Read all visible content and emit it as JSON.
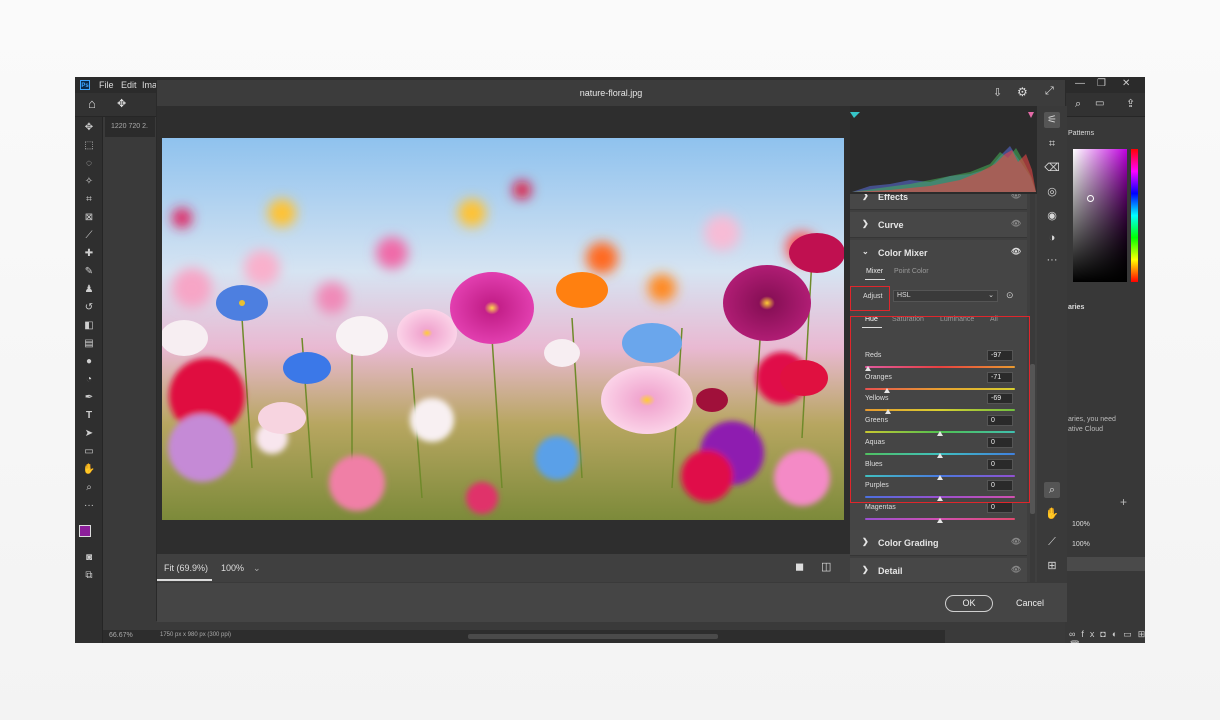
{
  "app": {
    "logo": "Ps",
    "menu": [
      "File",
      "Edit",
      "Ima"
    ],
    "doc_size_label": "1220 720 2.",
    "zoom_status": "66.67%",
    "doc_info": "1750 px x 980 px (300 ppi)"
  },
  "right_panel": {
    "patterns_label": "Patterns",
    "libraries_label": "aries",
    "libraries_msg_1": "aries, you need",
    "libraries_msg_2": "ative Cloud",
    "pct_1": "100%",
    "pct_2": "100%"
  },
  "dialog": {
    "title": "nature-floral.jpg",
    "zoom_fit": "Fit (69.9%)",
    "zoom_100": "100%",
    "ok_label": "OK",
    "cancel_label": "Cancel"
  },
  "sections": {
    "effects": "Effects",
    "curve": "Curve",
    "color_mixer": "Color Mixer",
    "color_grading": "Color Grading",
    "detail": "Detail"
  },
  "mixer": {
    "tabs": [
      "Mixer",
      "Point Color"
    ],
    "adjust_label": "Adjust",
    "adjust_value": "HSL",
    "subtabs": [
      "Hue",
      "Saturation",
      "Luminance",
      "All"
    ],
    "sliders": [
      {
        "name": "Reds",
        "value": "-97",
        "pos": 0.02
      },
      {
        "name": "Oranges",
        "value": "-71",
        "pos": 0.145
      },
      {
        "name": "Yellows",
        "value": "-69",
        "pos": 0.155
      },
      {
        "name": "Greens",
        "value": "0",
        "pos": 0.5
      },
      {
        "name": "Aquas",
        "value": "0",
        "pos": 0.5
      },
      {
        "name": "Blues",
        "value": "0",
        "pos": 0.5
      },
      {
        "name": "Purples",
        "value": "0",
        "pos": 0.5
      },
      {
        "name": "Magentas",
        "value": "0",
        "pos": 0.5
      }
    ]
  },
  "colors": {
    "highlight": "#e0262c",
    "accent": "#36c5c8"
  }
}
